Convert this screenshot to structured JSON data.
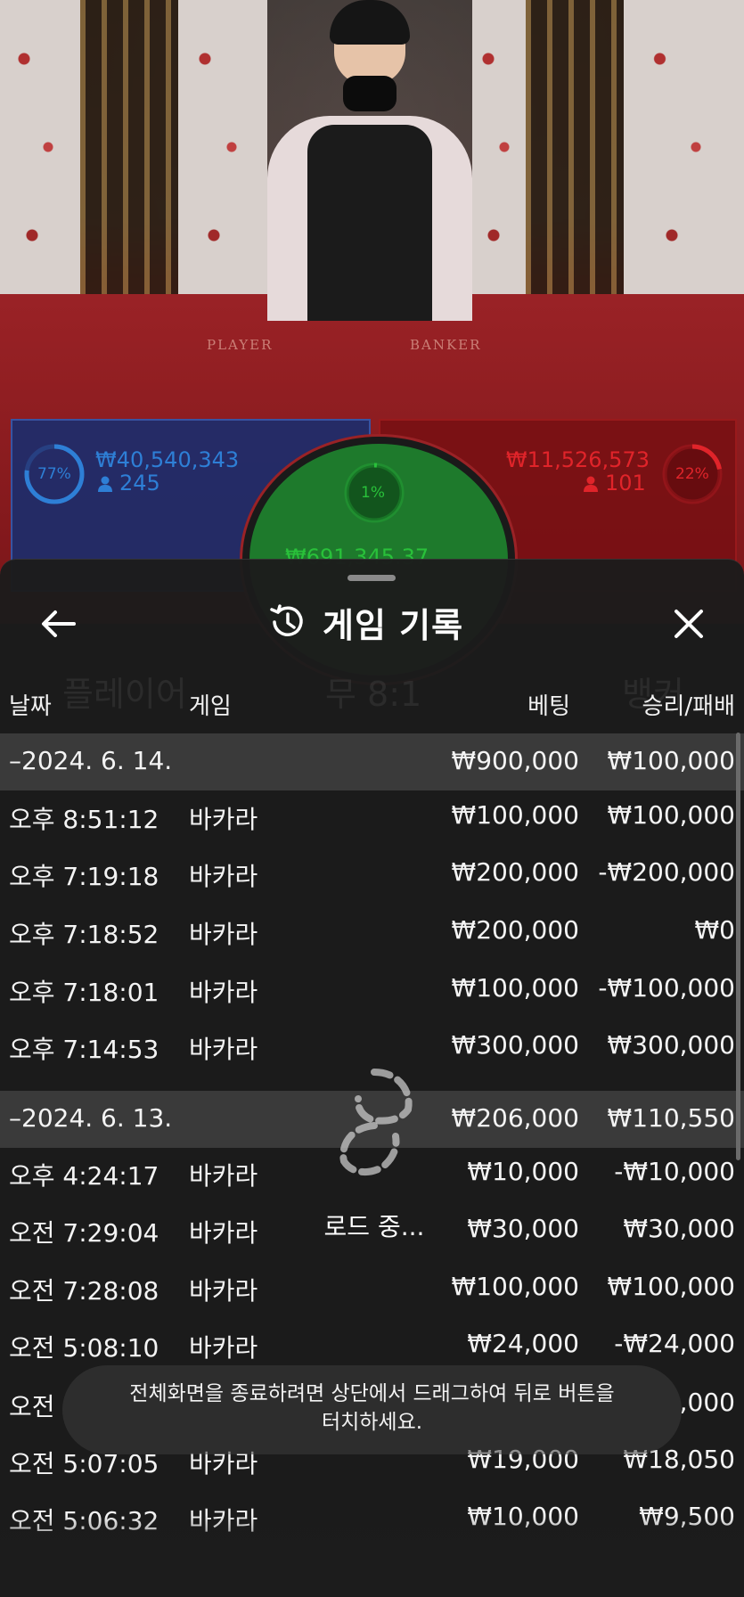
{
  "bet_panels": {
    "player": {
      "percent": "77%",
      "amount": "₩40,540,343",
      "players": "245"
    },
    "tie": {
      "percent": "1%",
      "amount": "₩691,345.37"
    },
    "banker": {
      "percent": "22%",
      "amount": "₩11,526,573",
      "players": "101"
    }
  },
  "table_labels": {
    "player": "PLAYER",
    "banker": "BANKER"
  },
  "ghost_bg": {
    "player": "플레이어",
    "tie": "무 8:1",
    "banker": "뱅커"
  },
  "header": {
    "title": "게임 기록"
  },
  "columns": {
    "date": "날짜",
    "game": "게임",
    "bet": "베팅",
    "result": "승리/패배"
  },
  "history": [
    {
      "type": "date",
      "time": "–2024. 6. 14.",
      "game": "",
      "bet": "₩900,000",
      "result": "₩100,000"
    },
    {
      "type": "entry",
      "time": "오후 8:51:12",
      "game": "바카라",
      "bet": "₩100,000",
      "result": "₩100,000"
    },
    {
      "type": "entry",
      "time": "오후 7:19:18",
      "game": "바카라",
      "bet": "₩200,000",
      "result": "-₩200,000"
    },
    {
      "type": "entry",
      "time": "오후 7:18:52",
      "game": "바카라",
      "bet": "₩200,000",
      "result": "₩0"
    },
    {
      "type": "entry",
      "time": "오후 7:18:01",
      "game": "바카라",
      "bet": "₩100,000",
      "result": "-₩100,000"
    },
    {
      "type": "entry",
      "time": "오후 7:14:53",
      "game": "바카라",
      "bet": "₩300,000",
      "result": "₩300,000"
    },
    {
      "type": "date",
      "time": "–2024. 6. 13.",
      "game": "",
      "bet": "₩206,000",
      "result": "₩110,550"
    },
    {
      "type": "entry",
      "time": "오후 4:24:17",
      "game": "바카라",
      "bet": "₩10,000",
      "result": "-₩10,000"
    },
    {
      "type": "entry",
      "time": "오전 7:29:04",
      "game": "바카라",
      "bet": "₩30,000",
      "result": "₩30,000"
    },
    {
      "type": "entry",
      "time": "오전 7:28:08",
      "game": "바카라",
      "bet": "₩100,000",
      "result": "₩100,000"
    },
    {
      "type": "entry",
      "time": "오전 5:08:10",
      "game": "바카라",
      "bet": "₩24,000",
      "result": "-₩24,000"
    },
    {
      "type": "entry",
      "time": "오전",
      "game": "",
      "bet": "",
      "result": ",000"
    },
    {
      "type": "entry",
      "time": "오전 5:07:05",
      "game": "바카라",
      "bet": "₩19,000",
      "result": "₩18,050"
    },
    {
      "type": "entry",
      "time": "오전 5:06:32",
      "game": "바카라",
      "bet": "₩10,000",
      "result": "₩9,500"
    }
  ],
  "loading": {
    "text": "로드 중..."
  },
  "toast": {
    "line1": "전체화면을 종료하려면 상단에서 드래그하여 뒤로 버튼을",
    "line2": "터치하세요."
  },
  "colors": {
    "player": "#2e7fd6",
    "banker": "#e0242a",
    "tie": "#29c13a",
    "panel": "#1c1c1c",
    "date_row": "#3a3a3a"
  },
  "icons": {
    "back": "arrow-left-icon",
    "history": "history-icon",
    "close": "close-icon",
    "loader": "loading-spinner-icon",
    "person": "person-icon"
  }
}
